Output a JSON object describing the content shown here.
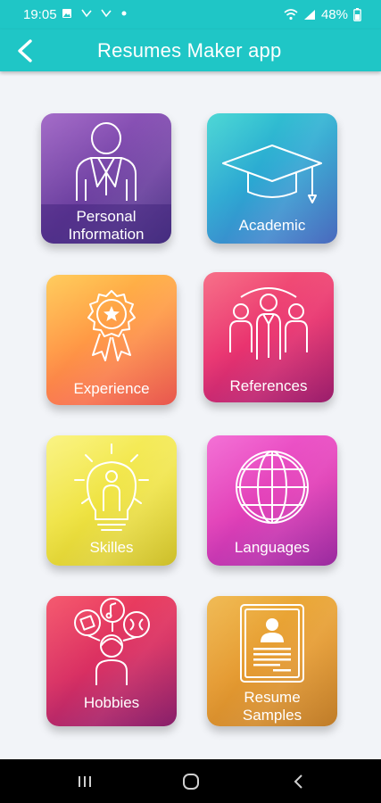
{
  "status_bar": {
    "time": "19:05",
    "battery": "48%",
    "icons": [
      "image-icon",
      "missed-call-icon",
      "missed-call-icon",
      "dot-icon",
      "wifi-icon",
      "signal-icon",
      "battery-icon"
    ]
  },
  "app_bar": {
    "title": "Resumes Maker app",
    "back_icon": "arrow-left-icon",
    "color": "#1fc6c6"
  },
  "tiles": [
    {
      "label_line1": "Personal",
      "label_line2": "Information",
      "icon": "person-suit-icon",
      "colors": [
        "#8a4fb5",
        "#5a3a9a"
      ]
    },
    {
      "label_line1": "Academic",
      "label_line2": "",
      "icon": "graduation-cap-icon",
      "colors": [
        "#2fcad0",
        "#4a72c8"
      ]
    },
    {
      "label_line1": "Experience",
      "label_line2": "",
      "icon": "award-badge-icon",
      "colors": [
        "#ffb13b",
        "#f4564f"
      ]
    },
    {
      "label_line1": "References",
      "label_line2": "",
      "icon": "people-group-icon",
      "colors": [
        "#f0456f",
        "#b8207a"
      ]
    },
    {
      "label_line1": "Skilles",
      "label_line2": "",
      "icon": "lightbulb-person-icon",
      "colors": [
        "#f4ea4a",
        "#d3c827"
      ]
    },
    {
      "label_line1": "Languages",
      "label_line2": "",
      "icon": "globe-icon",
      "colors": [
        "#ef4fc4",
        "#a42eaa"
      ]
    },
    {
      "label_line1": "Hobbies",
      "label_line2": "",
      "icon": "hobbies-icon",
      "colors": [
        "#f0405a",
        "#9b1f6c"
      ]
    },
    {
      "label_line1": "Resume",
      "label_line2": "Samples",
      "icon": "resume-document-icon",
      "colors": [
        "#e8a531",
        "#c98028"
      ]
    }
  ],
  "nav_bar": {
    "icons": [
      "recent-apps-icon",
      "home-icon",
      "back-icon"
    ]
  }
}
